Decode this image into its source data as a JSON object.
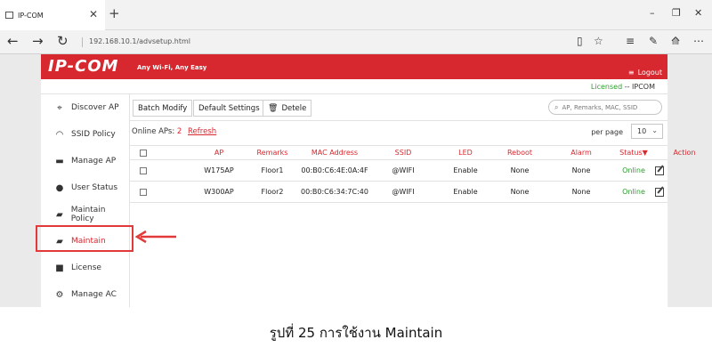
{
  "browser": {
    "tab_title": "IP-COM",
    "url": "192.168.10.1/advsetup.html",
    "tab_close": "✕",
    "new_tab": "+",
    "back": "←",
    "forward": "→",
    "refresh": "↻",
    "minimize": "–",
    "maximize": "❐",
    "close": "✕",
    "tools": [
      "▯",
      "☆",
      "≡",
      "✎",
      "⟰",
      "⋯"
    ]
  },
  "header": {
    "logo": "IP-COM",
    "tagline": "Any Wi-Fi, Any Easy",
    "logout": "Logout",
    "licensed": "Licensed",
    "license_owner": "-- IPCOM"
  },
  "sidebar": {
    "items": [
      {
        "label": "Discover AP",
        "icon": "satellite-icon",
        "glyph": "⌖"
      },
      {
        "label": "SSID Policy",
        "icon": "wifi-icon",
        "glyph": "◠"
      },
      {
        "label": "Manage AP",
        "icon": "router-icon",
        "glyph": "▬"
      },
      {
        "label": "User Status",
        "icon": "users-icon",
        "glyph": "●"
      },
      {
        "label": "Maintain Policy",
        "icon": "folder-open-icon",
        "glyph": "▰"
      },
      {
        "label": "Maintain",
        "icon": "folder-icon",
        "glyph": "▰",
        "active": true
      },
      {
        "label": "License",
        "icon": "lock-icon",
        "glyph": "■"
      },
      {
        "label": "Manage AC",
        "icon": "gears-icon",
        "glyph": "⚙"
      }
    ]
  },
  "toolbar": {
    "batch_modify": "Batch Modify",
    "default_settings": "Default Settings",
    "delete": "Detele",
    "search_placeholder": "AP, Remarks, MAC, SSID"
  },
  "status_bar": {
    "online_label": "Online APs:",
    "online_count": "2",
    "refresh": "Refresh",
    "per_page_label": "per page",
    "per_page_value": "10"
  },
  "table": {
    "headers": [
      "AP",
      "Remarks",
      "MAC Address",
      "SSID",
      "LED",
      "Reboot",
      "Alarm",
      "Status▼",
      "Action"
    ],
    "rows": [
      {
        "ap": "W175AP",
        "remarks": "Floor1",
        "mac": "00:B0:C6:4E:0A:4F",
        "ssid": "@WIFI",
        "led": "Enable",
        "reboot": "None",
        "alarm": "None",
        "status": "Online"
      },
      {
        "ap": "W300AP",
        "remarks": "Floor2",
        "mac": "00:B0:C6:34:7C:40",
        "ssid": "@WIFI",
        "led": "Enable",
        "reboot": "None",
        "alarm": "None",
        "status": "Online"
      }
    ]
  },
  "colors": {
    "brand_red": "#d7282f",
    "online_green": "#2e9e2e",
    "highlight_red": "#e23a3a"
  },
  "caption": "รูปที่ 25 การใช้งาน Maintain"
}
